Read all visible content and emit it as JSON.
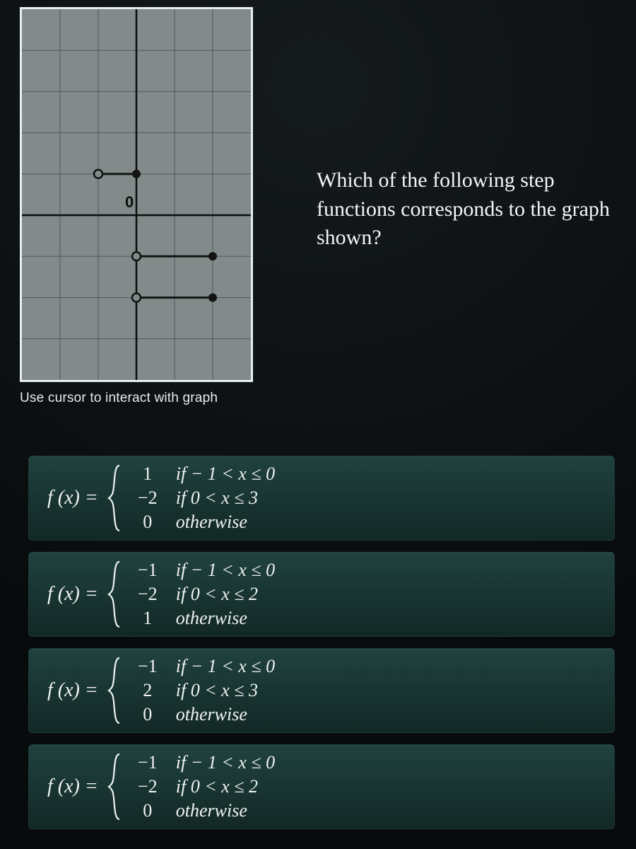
{
  "question": "Which of the following step functions corresponds to the graph shown?",
  "graph_caption": "Use cursor to interact with graph",
  "origin_label": "0",
  "fx_label": "f (x) =",
  "answers": [
    {
      "cases": [
        {
          "val": "1",
          "cond": "if − 1 < x ≤ 0"
        },
        {
          "val": "−2",
          "cond": "if 0 < x ≤ 3"
        },
        {
          "val": "0",
          "cond": "otherwise"
        }
      ]
    },
    {
      "cases": [
        {
          "val": "−1",
          "cond": "if − 1 < x ≤ 0"
        },
        {
          "val": "−2",
          "cond": "if 0 < x ≤ 2"
        },
        {
          "val": "1",
          "cond": "otherwise"
        }
      ]
    },
    {
      "cases": [
        {
          "val": "−1",
          "cond": "if − 1 < x ≤ 0"
        },
        {
          "val": "2",
          "cond": "if 0 < x ≤ 3"
        },
        {
          "val": "0",
          "cond": "otherwise"
        }
      ]
    },
    {
      "cases": [
        {
          "val": "−1",
          "cond": "if − 1 < x ≤ 0"
        },
        {
          "val": "−2",
          "cond": "if 0 < x ≤ 2"
        },
        {
          "val": "0",
          "cond": "otherwise"
        }
      ]
    }
  ],
  "chart_data": {
    "type": "line",
    "title": "",
    "xlabel": "",
    "ylabel": "",
    "xlim": [
      -3,
      3
    ],
    "ylim": [
      -4,
      5
    ],
    "grid": true,
    "segments": [
      {
        "y": 1,
        "x_from": -1,
        "x_to": 0,
        "open": "left",
        "closed": "right"
      },
      {
        "y": -1,
        "x_from": 0,
        "x_to": 2,
        "open": "left",
        "closed": "none",
        "endpoints": [
          "open_left",
          "arrow_right_hint"
        ]
      },
      {
        "y": -2,
        "x_from": 0,
        "x_to": 2,
        "open": "left",
        "closed": "right"
      }
    ],
    "default_value": 0
  }
}
